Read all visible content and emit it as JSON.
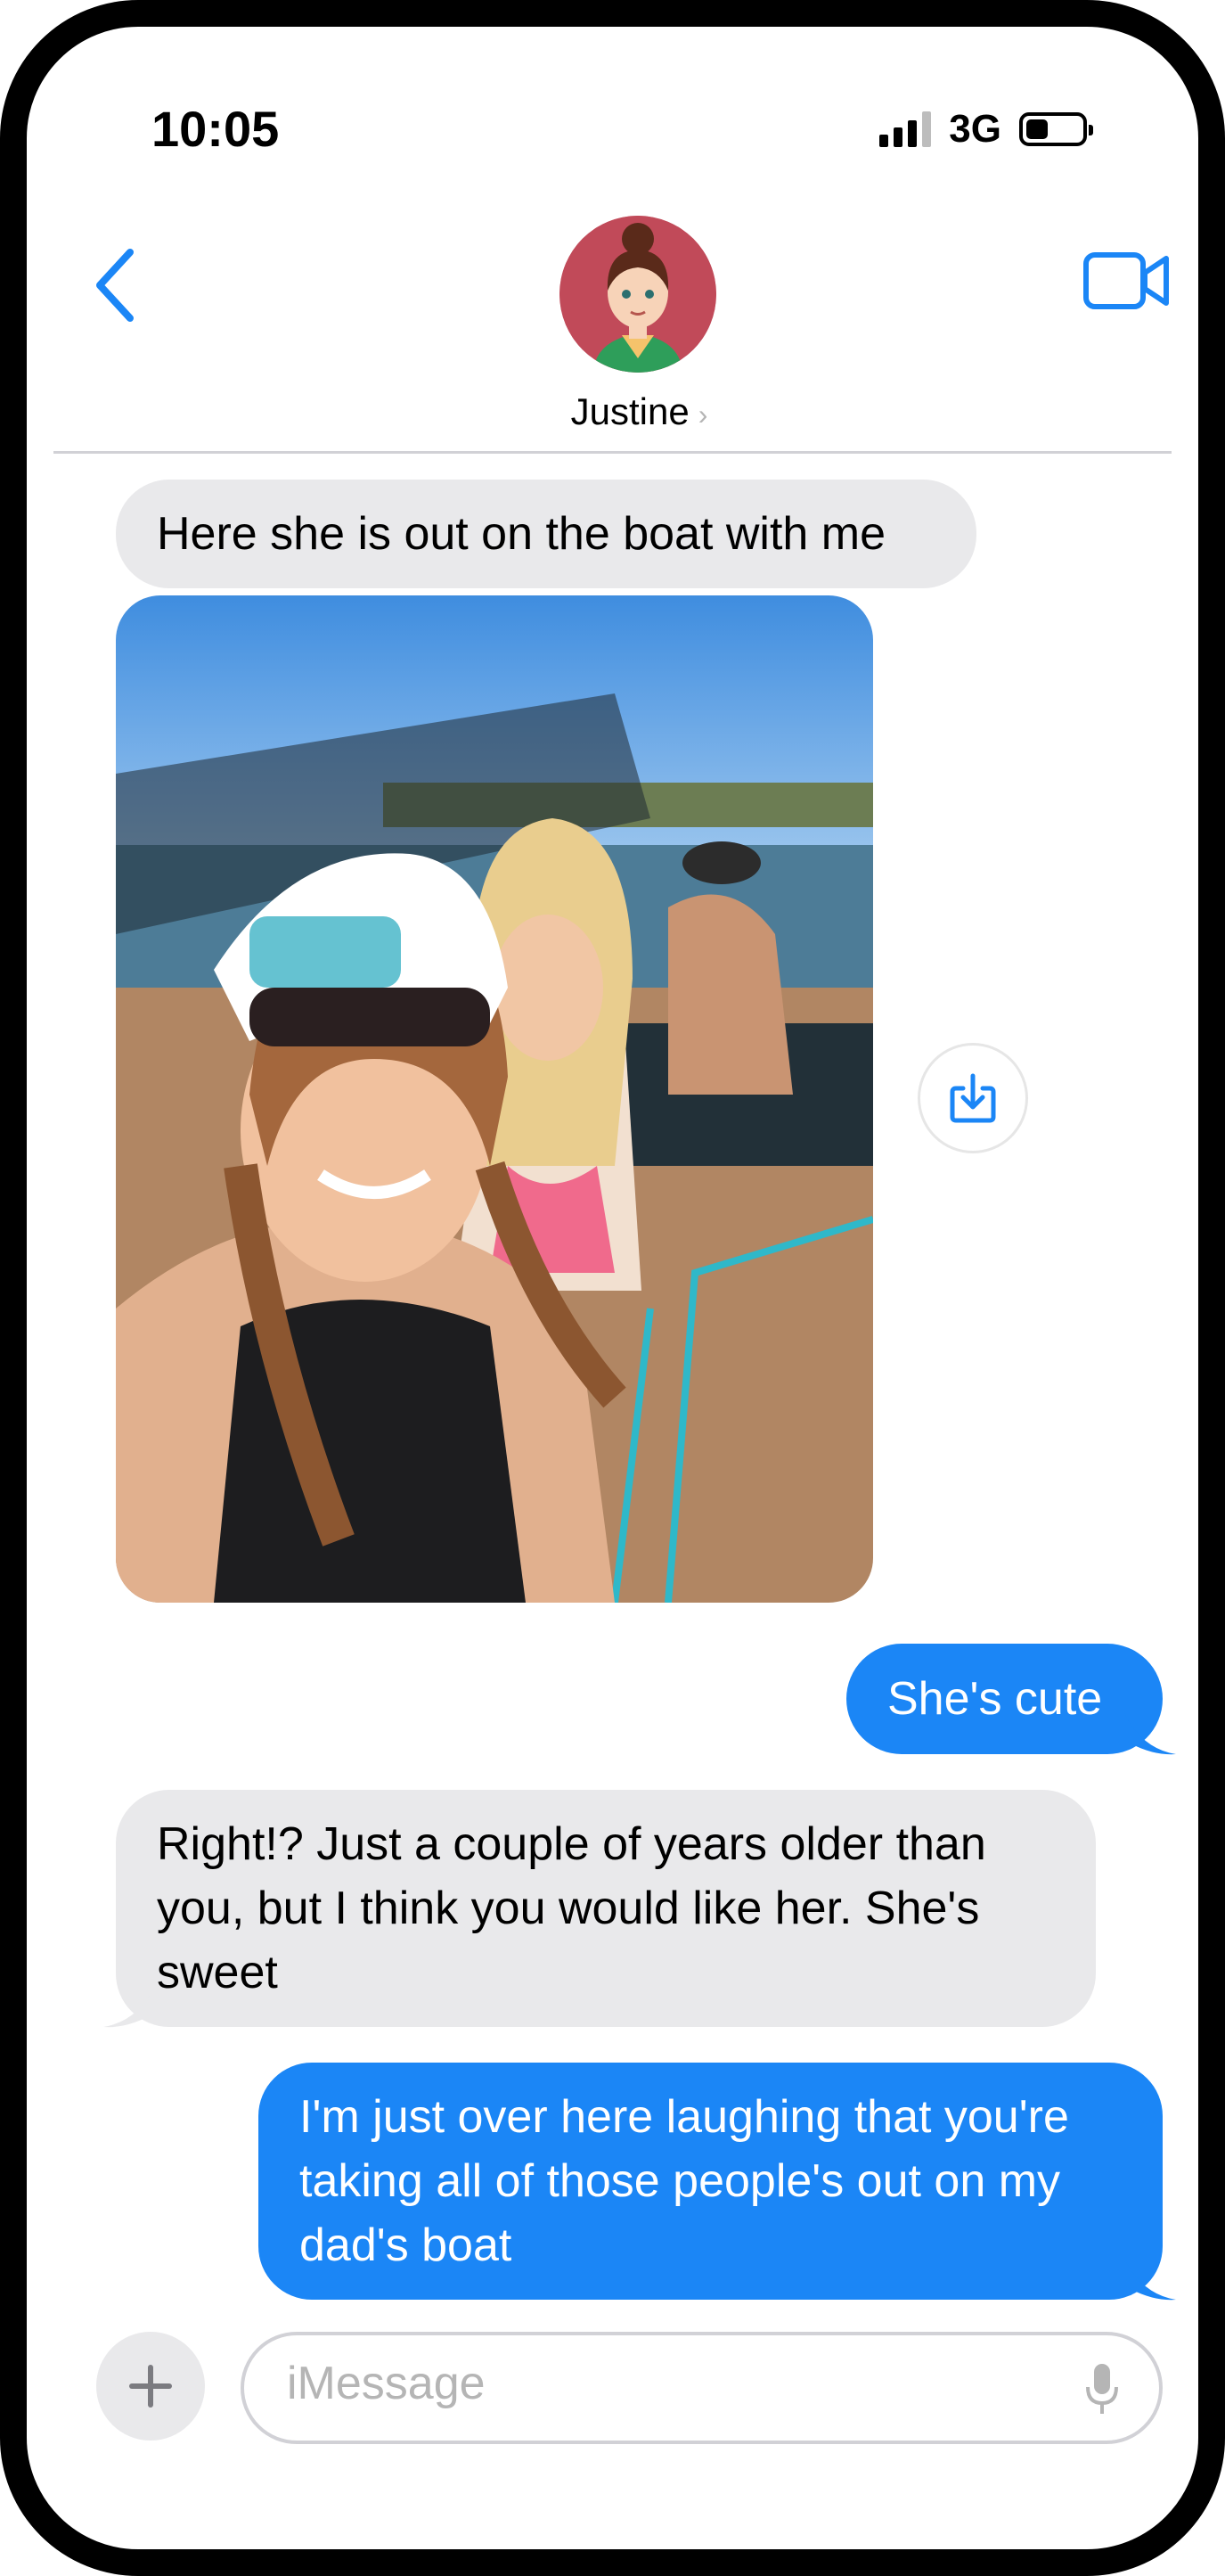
{
  "status_bar": {
    "time": "10:05",
    "network": "3G"
  },
  "contact": {
    "name": "Justine",
    "chevron": "›"
  },
  "messages": [
    {
      "from": "them",
      "text": "Here she is out on the boat with me"
    },
    {
      "from": "them",
      "type": "photo"
    },
    {
      "from": "me",
      "text": "She's cute"
    },
    {
      "from": "them",
      "text": "Right!?  Just a couple of years older than you, but I think you would like her.  She's sweet"
    },
    {
      "from": "me",
      "text": "I'm just over here laughing that you're taking all of those people's out on my dad's boat"
    }
  ],
  "composer": {
    "placeholder": "iMessage",
    "plus": "+"
  },
  "icons": [
    "back-chevron-icon",
    "video-camera-icon",
    "save-download-icon",
    "plus-icon",
    "microphone-icon"
  ],
  "colors": {
    "accent": "#1b86f6",
    "incoming": "#e9e9eb"
  }
}
